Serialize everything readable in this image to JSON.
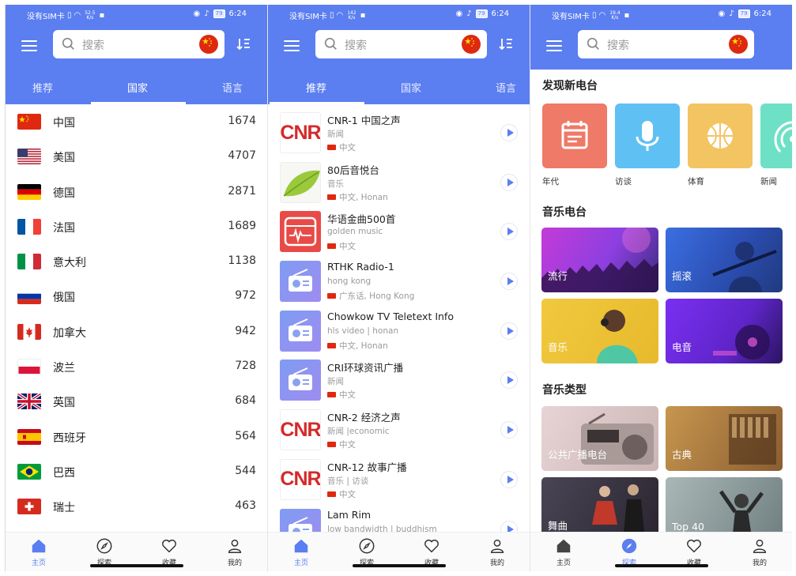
{
  "theme": {
    "accent": "#5b7ef0"
  },
  "statusbar": [
    {
      "carrier": "没有SIM卡",
      "speed_value": "52.5",
      "speed_unit": "K/s",
      "battery": "79",
      "time": "6:24"
    },
    {
      "carrier": "没有SIM卡",
      "speed_value": "142",
      "speed_unit": "K/s",
      "battery": "79",
      "time": "6:24"
    },
    {
      "carrier": "没有SIM卡",
      "speed_value": "19.4",
      "speed_unit": "K/s",
      "battery": "79",
      "time": "6:24"
    }
  ],
  "search": {
    "placeholder": "搜索"
  },
  "tabs": [
    "推荐",
    "国家",
    "语言"
  ],
  "countries": [
    {
      "name": "中国",
      "count": "1674",
      "flag": "cn"
    },
    {
      "name": "美国",
      "count": "4707",
      "flag": "us"
    },
    {
      "name": "德国",
      "count": "2871",
      "flag": "de"
    },
    {
      "name": "法国",
      "count": "1689",
      "flag": "fr"
    },
    {
      "name": "意大利",
      "count": "1138",
      "flag": "it"
    },
    {
      "name": "俄国",
      "count": "972",
      "flag": "ru"
    },
    {
      "name": "加拿大",
      "count": "942",
      "flag": "ca"
    },
    {
      "name": "波兰",
      "count": "728",
      "flag": "pl"
    },
    {
      "name": "英国",
      "count": "684",
      "flag": "gb"
    },
    {
      "name": "西班牙",
      "count": "564",
      "flag": "es"
    },
    {
      "name": "巴西",
      "count": "544",
      "flag": "br"
    },
    {
      "name": "瑞士",
      "count": "463",
      "flag": "ch"
    }
  ],
  "stations": [
    {
      "name": "CNR-1 中国之声",
      "tags": "新闻",
      "lang": "中文",
      "logo": "cnr"
    },
    {
      "name": "80后音悦台",
      "tags": "音乐",
      "lang": "中文, Honan",
      "logo": "leaf"
    },
    {
      "name": "华语金曲500首",
      "tags": "golden music",
      "lang": "中文",
      "logo": "musicbox"
    },
    {
      "name": "RTHK Radio-1",
      "tags": "hong kong",
      "lang": "广东话, Hong Kong",
      "logo": "radio"
    },
    {
      "name": "Chowkow TV Teletext Info",
      "tags": "hls video | honan",
      "lang": "中文, Honan",
      "logo": "radio"
    },
    {
      "name": "CRI环球资讯广播",
      "tags": "新闻",
      "lang": "中文",
      "logo": "radio"
    },
    {
      "name": "CNR-2 经济之声",
      "tags": "新闻 |economic",
      "lang": "中文",
      "logo": "cnr"
    },
    {
      "name": "CNR-12 故事广播",
      "tags": "音乐 | 访谈",
      "lang": "中文",
      "logo": "cnr"
    },
    {
      "name": "Lam Rim",
      "tags": "low bandwidth | buddhism",
      "lang": "",
      "logo": "radio"
    }
  ],
  "cnr_logo_text": "CNR",
  "explore": {
    "discover_title": "发现新电台",
    "categories": [
      {
        "label": "年代",
        "color": "#ee7a67",
        "icon": "calendar-icon"
      },
      {
        "label": "访谈",
        "color": "#5fc0f3",
        "icon": "microphone-icon"
      },
      {
        "label": "体育",
        "color": "#f3c462",
        "icon": "basketball-icon"
      },
      {
        "label": "新闻",
        "color": "#6ee0c6",
        "icon": "broadcast-icon"
      }
    ],
    "music_stations_title": "音乐电台",
    "music_stations": [
      {
        "label": "流行"
      },
      {
        "label": "摇滚"
      },
      {
        "label": "音乐"
      },
      {
        "label": "电音"
      }
    ],
    "music_genres_title": "音乐类型",
    "music_genres": [
      {
        "label": "公共广播电台"
      },
      {
        "label": "古典"
      },
      {
        "label": "舞曲"
      },
      {
        "label": "Top 40"
      }
    ]
  },
  "bottomnav": [
    {
      "label": "主页",
      "icon": "home-icon"
    },
    {
      "label": "探索",
      "icon": "compass-icon"
    },
    {
      "label": "收藏",
      "icon": "heart-icon"
    },
    {
      "label": "我的",
      "icon": "person-icon"
    }
  ]
}
